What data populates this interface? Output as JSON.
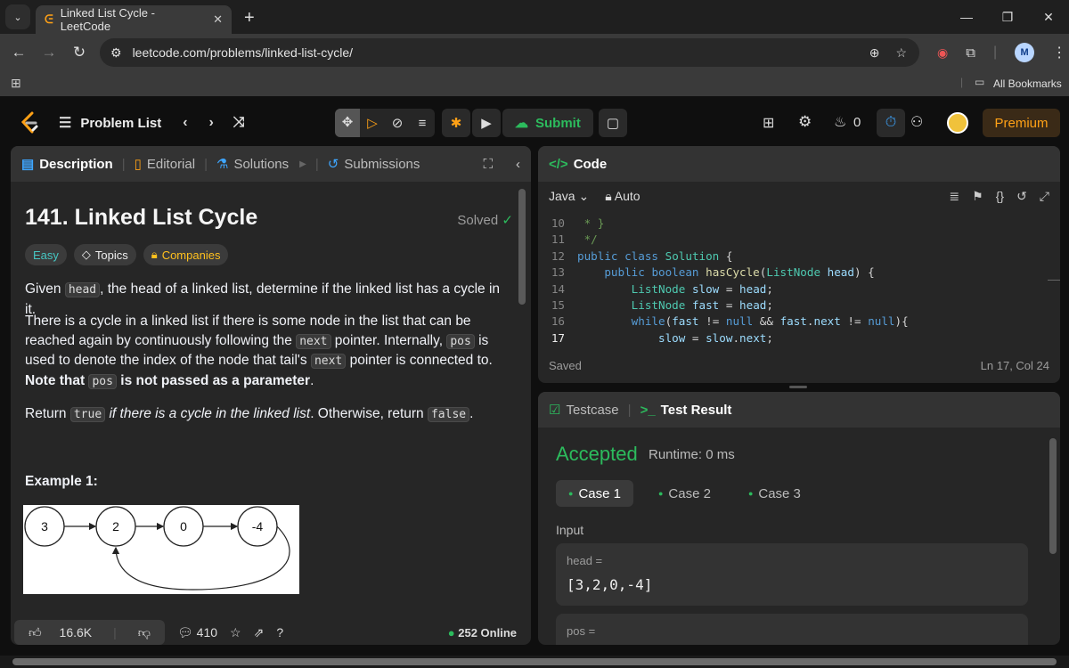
{
  "browser": {
    "tab_title": "Linked List Cycle - LeetCode",
    "url": "leetcode.com/problems/linked-list-cycle/",
    "profile_initial": "M",
    "bookmarks_label": "All Bookmarks"
  },
  "header": {
    "problem_list_label": "Problem List",
    "submit_label": "Submit",
    "streak_count": "0",
    "premium_label": "Premium"
  },
  "left_tabs": [
    "Description",
    "Editorial",
    "Solutions",
    "Submissions"
  ],
  "problem": {
    "title": "141. Linked List Cycle",
    "status": "Solved",
    "difficulty": "Easy",
    "topics_label": "Topics",
    "companies_label": "Companies",
    "p1_a": "Given ",
    "p1_code": "head",
    "p1_b": ", the head of a linked list, determine if the linked list has a cycle in it.",
    "p2_a": "There is a cycle in a linked list if there is some node in the list that can be reached again by continuously following the ",
    "p2_code1": "next",
    "p2_b": " pointer. Internally, ",
    "p2_code2": "pos",
    "p2_c": " is used to denote the index of the node that tail's ",
    "p2_code3": "next",
    "p2_d": " pointer is connected to. ",
    "p2_bold1": "Note that ",
    "p2_code4": "pos",
    "p2_bold2": " is not passed as a parameter",
    "p2_e": ".",
    "p3_a": "Return ",
    "p3_code1": "true",
    "p3_italic": " if there is a cycle in the linked list",
    "p3_b": ". Otherwise, return ",
    "p3_code2": "false",
    "p3_c": ".",
    "example_label": "Example 1:",
    "diagram_nodes": [
      "3",
      "2",
      "0",
      "-4"
    ]
  },
  "footer": {
    "likes": "16.6K",
    "comments": "410",
    "online": "252 Online"
  },
  "code": {
    "tab_label": "Code",
    "language": "Java",
    "mode": "Auto",
    "status": "Saved",
    "cursor": "Ln 17, Col 24",
    "lines": [
      {
        "n": "10",
        "text": " * }"
      },
      {
        "n": "11",
        "text": " */"
      },
      {
        "n": "12",
        "text": "public class Solution {"
      },
      {
        "n": "13",
        "text": "    public boolean hasCycle(ListNode head) {"
      },
      {
        "n": "14",
        "text": "        ListNode slow = head;"
      },
      {
        "n": "15",
        "text": "        ListNode fast = head;"
      },
      {
        "n": "16",
        "text": "        while(fast != null && fast.next != null){"
      },
      {
        "n": "17",
        "text": "            slow = slow.next;"
      }
    ]
  },
  "result": {
    "testcase_tab": "Testcase",
    "result_tab": "Test Result",
    "verdict": "Accepted",
    "runtime": "Runtime: 0 ms",
    "cases": [
      "Case 1",
      "Case 2",
      "Case 3"
    ],
    "input_label": "Input",
    "head_label": "head =",
    "head_value": "[3,2,0,-4]",
    "pos_label": "pos ="
  }
}
